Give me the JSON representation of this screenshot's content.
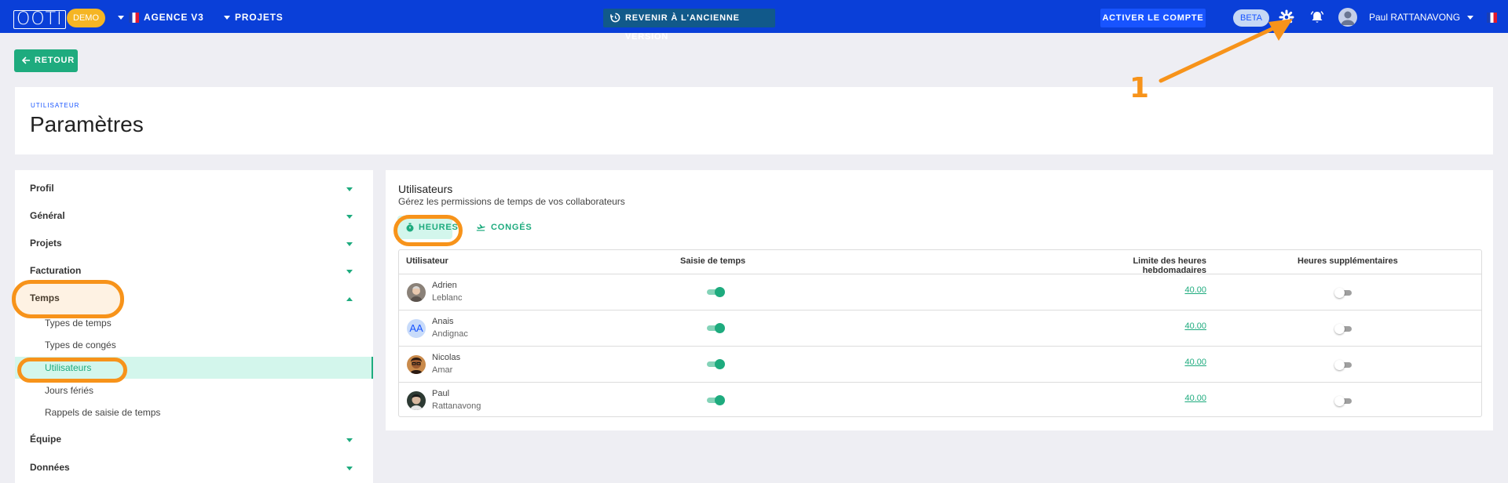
{
  "topbar": {
    "logo": "OOTI",
    "demo_badge": "DEMO",
    "agency": "AGENCE V3",
    "projects": "PROJETS",
    "revert_label": "REVENIR À L'ANCIENNE VERSION",
    "activate_label": "ACTIVER LE COMPTE",
    "beta_badge": "BETA",
    "user_name": "Paul RATTANAVONG",
    "icons": [
      "settings-icon",
      "notifications-icon",
      "user-avatar-icon",
      "french-flag-icon"
    ]
  },
  "back_button": "RETOUR",
  "header": {
    "kicker": "UTILISATEUR",
    "title": "Paramètres"
  },
  "sidebar": {
    "sections": [
      {
        "label": "Profil",
        "expanded": false
      },
      {
        "label": "Général",
        "expanded": false
      },
      {
        "label": "Projets",
        "expanded": false
      },
      {
        "label": "Facturation",
        "expanded": false
      },
      {
        "label": "Temps",
        "expanded": true
      },
      {
        "label": "Équipe",
        "expanded": false
      },
      {
        "label": "Données",
        "expanded": false
      }
    ],
    "temps_items": [
      "Types de temps",
      "Types de congés",
      "Utilisateurs",
      "Jours fériés",
      "Rappels de saisie de temps"
    ],
    "active_item": "Utilisateurs"
  },
  "main": {
    "title": "Utilisateurs",
    "subtitle": "Gérez les permissions de temps de vos collaborateurs",
    "tabs": [
      {
        "label": "HEURES",
        "active": true
      },
      {
        "label": "CONGÉS",
        "active": false
      }
    ],
    "table": {
      "columns": [
        "Utilisateur",
        "Saisie de temps",
        "Limite des heures hebdomadaires",
        "Heures supplémentaires"
      ],
      "rows": [
        {
          "first_name": "Adrien",
          "last_name": "Leblanc",
          "time_entry": true,
          "weekly_limit": "40.00",
          "overtime": false
        },
        {
          "first_name": "Anais",
          "last_name": "Andignac",
          "initials": "AA",
          "time_entry": true,
          "weekly_limit": "40.00",
          "overtime": false
        },
        {
          "first_name": "Nicolas",
          "last_name": "Amar",
          "time_entry": true,
          "weekly_limit": "40.00",
          "overtime": false
        },
        {
          "first_name": "Paul",
          "last_name": "Rattanavong",
          "time_entry": true,
          "weekly_limit": "40.00",
          "overtime": false
        }
      ]
    }
  },
  "annotation": {
    "step_number": "1",
    "color": "#f7931a"
  },
  "colors": {
    "topbar": "#0a3fd8",
    "accent_green": "#1eab7e",
    "active_bg": "#d3f6ec",
    "demo_yellow": "#f5b524"
  }
}
